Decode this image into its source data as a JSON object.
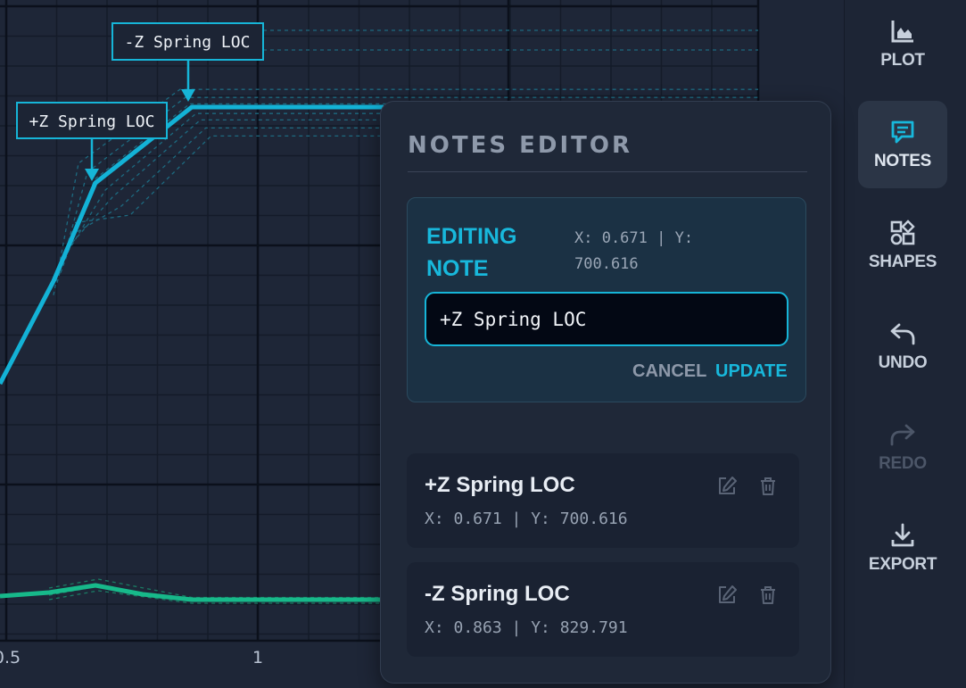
{
  "plot": {
    "x_tick_labels": [
      "0.5",
      "1"
    ],
    "annotations": [
      {
        "label": "-Z Spring LOC"
      },
      {
        "label": "+Z Spring LOC"
      }
    ],
    "colors": {
      "series_primary": "#13b2d6",
      "series_secondary": "#17b98a",
      "grid": "#0f1522",
      "background": "#1e2637"
    }
  },
  "toolbar": {
    "items": [
      {
        "label": "PLOT",
        "icon": "chart-icon",
        "active": false,
        "disabled": false
      },
      {
        "label": "NOTES",
        "icon": "comment-icon",
        "active": true,
        "disabled": false
      },
      {
        "label": "SHAPES",
        "icon": "shapes-icon",
        "active": false,
        "disabled": false
      },
      {
        "label": "UNDO",
        "icon": "undo-icon",
        "active": false,
        "disabled": false
      },
      {
        "label": "REDO",
        "icon": "redo-icon",
        "active": false,
        "disabled": true
      },
      {
        "label": "EXPORT",
        "icon": "download-icon",
        "active": false,
        "disabled": false
      }
    ]
  },
  "notes_editor": {
    "title": "NOTES EDITOR",
    "editing": {
      "label": "EDITING NOTE",
      "coords": "X: 0.671 | Y: 700.616",
      "input_value": "+Z Spring LOC",
      "cancel_label": "CANCEL",
      "update_label": "UPDATE"
    },
    "notes": [
      {
        "title": "+Z Spring LOC",
        "coords": "X: 0.671 | Y: 700.616"
      },
      {
        "title": "-Z Spring LOC",
        "coords": "X: 0.863 | Y: 829.791"
      }
    ],
    "accent_color": "#18b8dc"
  }
}
